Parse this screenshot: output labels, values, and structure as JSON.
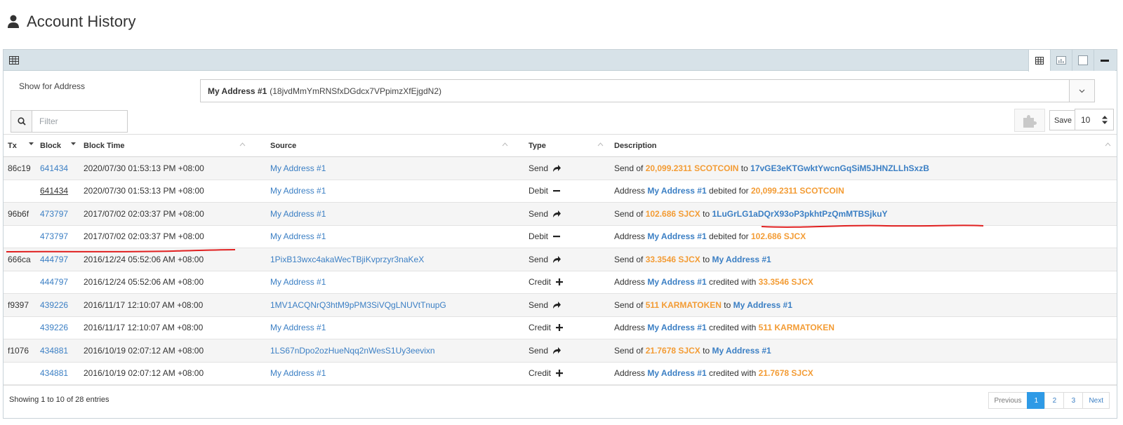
{
  "page": {
    "title": "Account History"
  },
  "address": {
    "label": "Show for Address",
    "selected_name": "My Address #1",
    "selected_detail": "(18jvdMmYmRNSfxDGdcx7VPpimzXfEjgdN2)"
  },
  "filter": {
    "placeholder": "Filter"
  },
  "toolbar": {
    "save_label": "Save",
    "page_size": "10"
  },
  "table": {
    "columns": {
      "tx": "Tx",
      "block": "Block",
      "block_time": "Block Time",
      "source": "Source",
      "type": "Type",
      "description": "Description"
    },
    "rows": [
      {
        "tx": "86c19",
        "block": "641434",
        "time": "2020/07/30 01:53:13 PM +08:00",
        "source": "My Address #1",
        "type": "Send",
        "icon": "send-arrow-icon",
        "desc": [
          {
            "t": "Send of ",
            "c": ""
          },
          {
            "t": "20,099.2311",
            "c": "amt"
          },
          {
            "t": " SCOTCOIN",
            "c": "amt"
          },
          {
            "t": " to ",
            "c": ""
          },
          {
            "t": "17vGE3eKTGwktYwcnGqSiM5JHNZLLhSxzB",
            "c": "addrb"
          }
        ]
      },
      {
        "tx": "",
        "block": "641434",
        "time": "2020/07/30 01:53:13 PM +08:00",
        "source": "My Address #1",
        "type": "Debit",
        "icon": "minus-icon",
        "desc": [
          {
            "t": "Address ",
            "c": ""
          },
          {
            "t": "My Address #1",
            "c": "addrb"
          },
          {
            "t": " debited for ",
            "c": ""
          },
          {
            "t": "20,099.2311",
            "c": "amt"
          },
          {
            "t": " SCOTCOIN",
            "c": "amt"
          }
        ]
      },
      {
        "tx": "96b6f",
        "block": "473797",
        "time": "2017/07/02 02:03:37 PM +08:00",
        "source": "My Address #1",
        "type": "Send",
        "icon": "send-arrow-icon",
        "desc": [
          {
            "t": "Send of ",
            "c": ""
          },
          {
            "t": "102.686",
            "c": "amt"
          },
          {
            "t": " SJCX",
            "c": "amt"
          },
          {
            "t": " to ",
            "c": ""
          },
          {
            "t": "1LuGrLG1aDQrX93oP3pkhtPzQmMTBSjkuY",
            "c": "addrb"
          }
        ]
      },
      {
        "tx": "",
        "block": "473797",
        "time": "2017/07/02 02:03:37 PM +08:00",
        "source": "My Address #1",
        "type": "Debit",
        "icon": "minus-icon",
        "desc": [
          {
            "t": "Address ",
            "c": ""
          },
          {
            "t": "My Address #1",
            "c": "addrb"
          },
          {
            "t": " debited for ",
            "c": ""
          },
          {
            "t": "102.686",
            "c": "amt"
          },
          {
            "t": " SJCX",
            "c": "amt"
          }
        ]
      },
      {
        "tx": "666ca",
        "block": "444797",
        "time": "2016/12/24 05:52:06 AM +08:00",
        "source": "1PixB13wxc4akaWecTBjiKvprzyr3naKeX",
        "type": "Send",
        "icon": "send-arrow-icon",
        "desc": [
          {
            "t": "Send of ",
            "c": ""
          },
          {
            "t": "33.3546",
            "c": "amt"
          },
          {
            "t": " SJCX",
            "c": "amt"
          },
          {
            "t": " to ",
            "c": ""
          },
          {
            "t": "My Address #1",
            "c": "addrb"
          }
        ]
      },
      {
        "tx": "",
        "block": "444797",
        "time": "2016/12/24 05:52:06 AM +08:00",
        "source": "My Address #1",
        "type": "Credit",
        "icon": "plus-icon",
        "desc": [
          {
            "t": "Address ",
            "c": ""
          },
          {
            "t": "My Address #1",
            "c": "addrb"
          },
          {
            "t": " credited with ",
            "c": ""
          },
          {
            "t": "33.3546",
            "c": "amt"
          },
          {
            "t": " SJCX",
            "c": "amt"
          }
        ]
      },
      {
        "tx": "f9397",
        "block": "439226",
        "time": "2016/11/17 12:10:07 AM +08:00",
        "source": "1MV1ACQNrQ3htM9pPM3SiVQgLNUVtTnupG",
        "type": "Send",
        "icon": "send-arrow-icon",
        "desc": [
          {
            "t": "Send of ",
            "c": ""
          },
          {
            "t": "511",
            "c": "amt"
          },
          {
            "t": " KARMATOKEN",
            "c": "amt"
          },
          {
            "t": " to ",
            "c": ""
          },
          {
            "t": "My Address #1",
            "c": "addrb"
          }
        ]
      },
      {
        "tx": "",
        "block": "439226",
        "time": "2016/11/17 12:10:07 AM +08:00",
        "source": "My Address #1",
        "type": "Credit",
        "icon": "plus-icon",
        "desc": [
          {
            "t": "Address ",
            "c": ""
          },
          {
            "t": "My Address #1",
            "c": "addrb"
          },
          {
            "t": " credited with ",
            "c": ""
          },
          {
            "t": "511",
            "c": "amt"
          },
          {
            "t": " KARMATOKEN",
            "c": "amt"
          }
        ]
      },
      {
        "tx": "f1076",
        "block": "434881",
        "time": "2016/10/19 02:07:12 AM +08:00",
        "source": "1LS67nDpo2ozHueNqq2nWesS1Uy3eevixn",
        "type": "Send",
        "icon": "send-arrow-icon",
        "desc": [
          {
            "t": "Send of ",
            "c": ""
          },
          {
            "t": "21.7678",
            "c": "amt"
          },
          {
            "t": " SJCX",
            "c": "amt"
          },
          {
            "t": " to ",
            "c": ""
          },
          {
            "t": "My Address #1",
            "c": "addrb"
          }
        ]
      },
      {
        "tx": "",
        "block": "434881",
        "time": "2016/10/19 02:07:12 AM +08:00",
        "source": "My Address #1",
        "type": "Credit",
        "icon": "plus-icon",
        "desc": [
          {
            "t": "Address ",
            "c": ""
          },
          {
            "t": "My Address #1",
            "c": "addrb"
          },
          {
            "t": " credited with ",
            "c": ""
          },
          {
            "t": "21.7678",
            "c": "amt"
          },
          {
            "t": " SJCX",
            "c": "amt"
          }
        ]
      }
    ]
  },
  "footer": {
    "info": "Showing 1 to 10 of 28 entries",
    "pages": [
      {
        "label": "Previous",
        "state": "disabled"
      },
      {
        "label": "1",
        "state": "active"
      },
      {
        "label": "2",
        "state": "num"
      },
      {
        "label": "3",
        "state": "num"
      },
      {
        "label": "Next",
        "state": ""
      }
    ]
  },
  "colors": {
    "link": "#3b7fc4",
    "amount": "#f39c35",
    "header_bar": "#d7e2e8",
    "annotation": "#e02020",
    "active_page": "#2e9ae6"
  },
  "icons": {
    "title": "user-icon",
    "header": "table-grid-icon",
    "filter": "search-icon",
    "toolbar": "puzzle-icon"
  }
}
